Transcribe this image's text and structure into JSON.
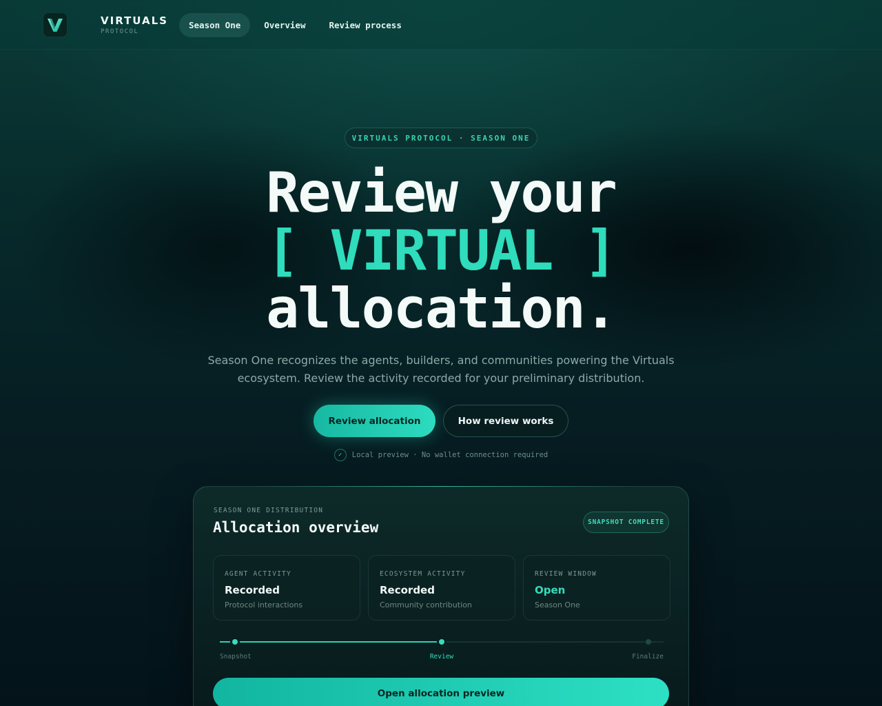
{
  "nav": {
    "brand_name": "VIRTUALS",
    "brand_sub": "PROTOCOL",
    "links": [
      {
        "label": "Season One",
        "active": true
      },
      {
        "label": "Overview",
        "active": false
      },
      {
        "label": "Review process",
        "active": false
      }
    ]
  },
  "hero": {
    "eyebrow": "VIRTUALS PROTOCOL · SEASON ONE",
    "title_line1": "Review your",
    "title_line2": "[ VIRTUAL ]",
    "title_line3": "allocation.",
    "lede": "Season One recognizes the agents, builders, and communities powering the Virtuals ecosystem. Review the activity recorded for your preliminary distribution.",
    "primary_button": "Review allocation",
    "secondary_button": "How review works",
    "note": "Local preview · No wallet connection required"
  },
  "card": {
    "eyebrow": "SEASON ONE DISTRIBUTION",
    "title": "Allocation overview",
    "badge": "SNAPSHOT COMPLETE",
    "stats": [
      {
        "label": "AGENT ACTIVITY",
        "value": "Recorded",
        "sub": "Protocol interactions"
      },
      {
        "label": "ECOSYSTEM ACTIVITY",
        "value": "Recorded",
        "sub": "Community contribution"
      },
      {
        "label": "REVIEW WINDOW",
        "value": "Open",
        "sub": "Season One"
      }
    ],
    "timeline": {
      "steps": [
        "Snapshot",
        "Review",
        "Finalize"
      ],
      "current_step": 2
    },
    "button": "Open allocation preview"
  },
  "colors": {
    "accent": "#2fdcbc",
    "background": "#061d22",
    "text": "#f3faf8"
  },
  "icons": {
    "logo": "v-logo-icon",
    "note": "check-icon"
  }
}
